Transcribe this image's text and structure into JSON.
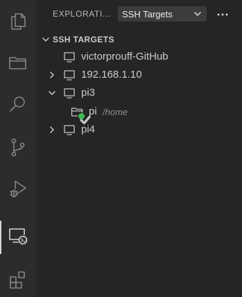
{
  "activity_bar": {
    "items": [
      {
        "name": "explorer",
        "icon": "files-icon",
        "active": false
      },
      {
        "name": "folder",
        "icon": "folder-icon",
        "active": false
      },
      {
        "name": "search",
        "icon": "search-icon",
        "active": false
      },
      {
        "name": "source-control",
        "icon": "source-control-icon",
        "active": false
      },
      {
        "name": "run-debug",
        "icon": "run-debug-icon",
        "active": false
      },
      {
        "name": "remote-explorer",
        "icon": "remote-explorer-icon",
        "active": true
      },
      {
        "name": "extensions",
        "icon": "extensions-icon",
        "active": false
      }
    ]
  },
  "sidebar": {
    "title": "EXPLORATI...",
    "view_select": {
      "selected": "SSH Targets",
      "icon": "chevron-down-icon"
    },
    "more_actions_icon": "ellipsis-icon",
    "section": {
      "title": "SSH TARGETS",
      "expanded": true
    },
    "tree": [
      {
        "label": "victorprouff-GitHub",
        "icon": "monitor-icon",
        "expanded": null
      },
      {
        "label": "192.168.1.10",
        "icon": "monitor-icon",
        "expanded": false
      },
      {
        "label": "pi3",
        "icon": "monitor-icon",
        "expanded": true
      },
      {
        "label": "pi",
        "description": "/home",
        "icon": "remote-folder-connected-icon",
        "expanded": null
      },
      {
        "label": "pi4",
        "icon": "monitor-icon",
        "expanded": false
      }
    ]
  },
  "colors": {
    "background": "#252526",
    "activity_bar": "#2c2c2c",
    "connected_status": "#3fb950"
  }
}
